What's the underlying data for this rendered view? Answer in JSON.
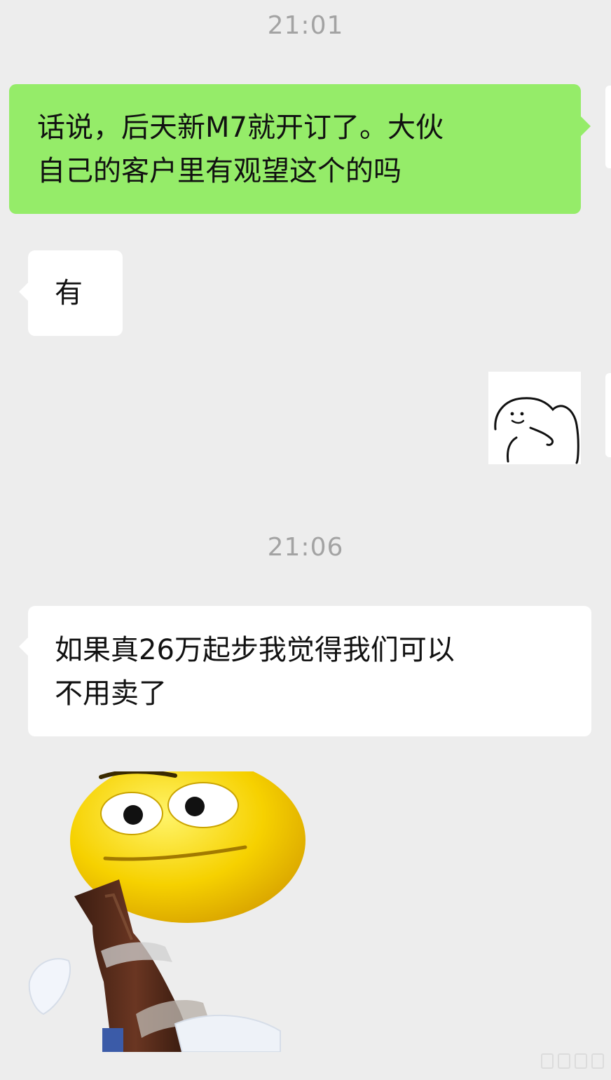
{
  "chat": {
    "messages": [
      {
        "type": "timestamp",
        "text": "21:01"
      },
      {
        "type": "text",
        "direction": "outgoing",
        "lines": [
          "话说，后天新M7就开订了。大伙",
          "自己的客户里有观望这个的吗"
        ]
      },
      {
        "type": "text",
        "direction": "incoming",
        "lines": [
          "有"
        ]
      },
      {
        "type": "sticker",
        "direction": "outgoing",
        "icon": "smiling-doodle-sticker"
      },
      {
        "type": "timestamp",
        "text": "21:06"
      },
      {
        "type": "text",
        "direction": "incoming",
        "lines": [
          "如果真26万起步我觉得我们可以",
          "不用卖了"
        ]
      },
      {
        "type": "sticker",
        "direction": "incoming",
        "icon": "yellow-emoji-with-bottle-sticker"
      }
    ]
  },
  "colors": {
    "background": "#ededed",
    "outgoing_bubble": "#95ec69",
    "incoming_bubble": "#ffffff",
    "timestamp_text": "#a3a3a3"
  }
}
